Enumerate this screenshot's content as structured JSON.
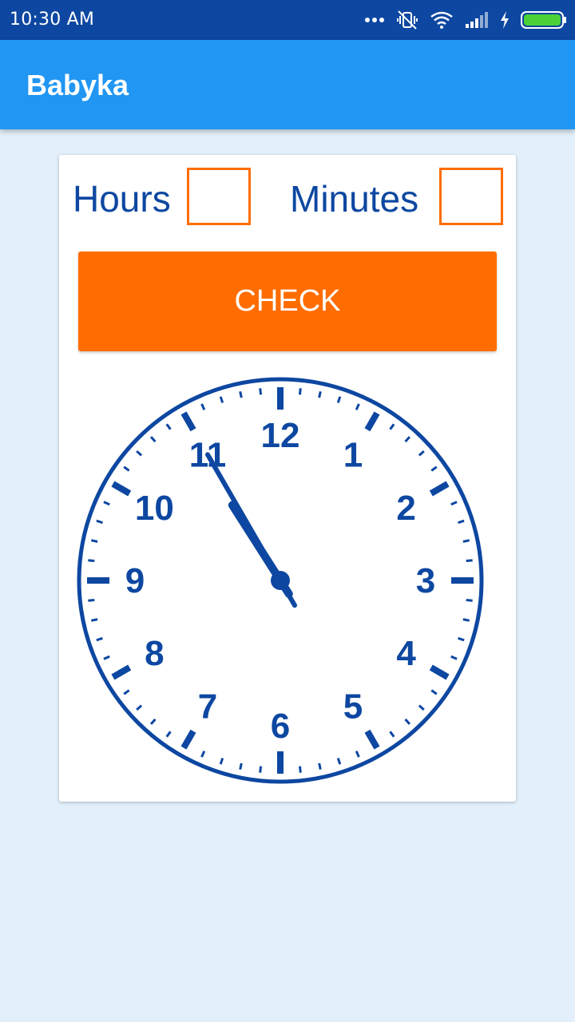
{
  "status_bar": {
    "time": "10:30 AM",
    "icons": [
      "more-dots-icon",
      "vibrate-off-icon",
      "wifi-icon",
      "signal-icon",
      "charging-icon",
      "battery-icon"
    ]
  },
  "app_bar": {
    "title": "Babyka"
  },
  "form": {
    "hours_label": "Hours",
    "hours_value": "",
    "minutes_label": "Minutes",
    "minutes_value": "",
    "check_label": "CHECK"
  },
  "clock": {
    "numbers": [
      "12",
      "1",
      "2",
      "3",
      "4",
      "5",
      "6",
      "7",
      "8",
      "9",
      "10",
      "11"
    ],
    "hour": 10,
    "minute": 55,
    "color": "#0d47a1"
  },
  "colors": {
    "status_bar": "#0d47a1",
    "app_bar": "#2196f3",
    "accent": "#ff6d00",
    "background": "#e3f0fb",
    "text": "#0d47a1"
  }
}
